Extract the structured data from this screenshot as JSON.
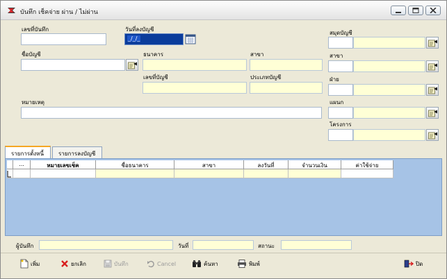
{
  "window": {
    "title": "บันทึก เช็คจ่าย ผ่าน / ไม่ผ่าน"
  },
  "form": {
    "record_no_label": "เลขที่บันทึก",
    "record_no_value": "",
    "post_date_label": "วันที่ลงบัญชี",
    "post_date_value": "_/_/_",
    "account_name_label": "ชื่อบัญชี",
    "account_name_value": "",
    "bank_label": "ธนาคาร",
    "bank_value": "",
    "branch_label": "สาขา",
    "branch_value": "",
    "account_no_label": "เลขที่บัญชี",
    "account_no_value": "",
    "account_type_label": "ประเภทบัญชี",
    "account_type_value": "",
    "note_label": "หมายเหตุ",
    "note_value": ""
  },
  "side": {
    "ledger_label": "สมุดบัญชี",
    "branch_label": "สาขา",
    "division_label": "ฝ่าย",
    "department_label": "แผนก",
    "project_label": "โครงการ"
  },
  "tabs": [
    {
      "label": "รายการตั้งหนี้",
      "active": true
    },
    {
      "label": "รายการลงบัญชี",
      "active": false
    }
  ],
  "grid": {
    "columns": [
      "...",
      "หมายเลขเช็ค",
      "ชื่อธนาคาร",
      "สาขา",
      "ลงวันที่",
      "จำนวนเงิน",
      "ค่าใช้จ่าย"
    ],
    "row_marker": "",
    "cells": [
      "",
      "",
      "",
      "",
      "",
      "",
      ""
    ]
  },
  "status": {
    "recorder_label": "ผู้บันทึก",
    "recorder_value": "",
    "date_label": "วันที่",
    "date_value": "",
    "status_label": "สถานะ",
    "status_value": ""
  },
  "toolbar": {
    "add_label": "เพิ่ม",
    "cancel_entry_label": "ยกเลิก",
    "save_label": "บันทึก",
    "cancel_label": "Cancel",
    "search_label": "ค้นหา",
    "print_label": "พิมพ์",
    "close_label": "ปิด"
  },
  "colors": {
    "window_bg": "#ece9d8",
    "field_yellow": "#ffffd6",
    "grid_bg": "#a6c3e6",
    "tab_accent": "#f5a623",
    "date_selected": "#0a3c9b"
  }
}
